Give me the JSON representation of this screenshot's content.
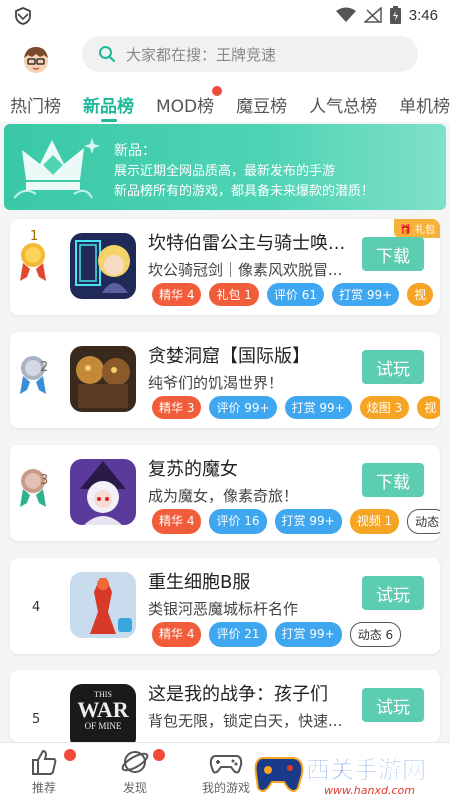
{
  "status": {
    "time": "3:46"
  },
  "search": {
    "placeholder": "大家都在搜：王牌竞速"
  },
  "tabs": [
    {
      "label": "热门榜",
      "active": false
    },
    {
      "label": "新品榜",
      "active": true
    },
    {
      "label": "MOD榜",
      "active": false,
      "dot": true
    },
    {
      "label": "魔豆榜",
      "active": false
    },
    {
      "label": "人气总榜",
      "active": false
    },
    {
      "label": "单机榜",
      "active": false
    }
  ],
  "banner": {
    "title": "新品：",
    "line1": "展示近期全网品质高，最新发布的手游",
    "line2": "新品榜所有的游戏，都具备未来爆款的潜质！"
  },
  "games": [
    {
      "rank": "1",
      "medal": "gold",
      "name": "坎特伯雷公主与骑士唤...",
      "desc": "坎公骑冠剑｜像素风欢脱冒...",
      "action": "下载",
      "gift": "礼包",
      "tags": [
        {
          "text": "精华 4",
          "color": "red"
        },
        {
          "text": "礼包 1",
          "color": "red"
        },
        {
          "text": "评价 61",
          "color": "blue"
        },
        {
          "text": "打赏 99+",
          "color": "blue"
        },
        {
          "text": "视",
          "color": "orange"
        }
      ]
    },
    {
      "rank": "2",
      "medal": "silver",
      "name": "贪婪洞窟【国际版】",
      "desc": "纯爷们的饥渴世界！",
      "action": "试玩",
      "tags": [
        {
          "text": "精华 3",
          "color": "red"
        },
        {
          "text": "评价 99+",
          "color": "blue"
        },
        {
          "text": "打赏 99+",
          "color": "blue"
        },
        {
          "text": "炫图 3",
          "color": "orange"
        },
        {
          "text": "视",
          "color": "orange"
        }
      ]
    },
    {
      "rank": "3",
      "medal": "bronze",
      "name": "复苏的魔女",
      "desc": "成为魔女，像素奇旅！",
      "action": "下载",
      "tags": [
        {
          "text": "精华 4",
          "color": "red"
        },
        {
          "text": "评价 16",
          "color": "blue"
        },
        {
          "text": "打赏 99+",
          "color": "blue"
        },
        {
          "text": "视频 1",
          "color": "orange"
        },
        {
          "text": "动态",
          "color": "outline"
        }
      ]
    },
    {
      "rank": "4",
      "name": "重生细胞B服",
      "desc": "类银河恶魔城标杆名作",
      "action": "试玩",
      "tags": [
        {
          "text": "精华 4",
          "color": "red"
        },
        {
          "text": "评价 21",
          "color": "blue"
        },
        {
          "text": "打赏 99+",
          "color": "blue"
        },
        {
          "text": "动态 6",
          "color": "outline"
        }
      ]
    },
    {
      "rank": "5",
      "name": "这是我的战争：孩子们",
      "desc": "背包无限，锁定白天，快速...",
      "action": "试玩",
      "icon_text": [
        "THIS",
        "WAR",
        "OF MINE"
      ],
      "tags": []
    }
  ],
  "nav": [
    {
      "label": "推荐",
      "icon": "thumbs-up-icon",
      "dot": true
    },
    {
      "label": "发现",
      "icon": "planet-icon",
      "dot": true
    },
    {
      "label": "我的游戏",
      "icon": "gamepad-icon",
      "dot": false
    }
  ],
  "colors": {
    "accent": "#1eb89a",
    "button": "#5ccdb0",
    "red": "#f15d3a",
    "blue": "#3fa6f0"
  }
}
